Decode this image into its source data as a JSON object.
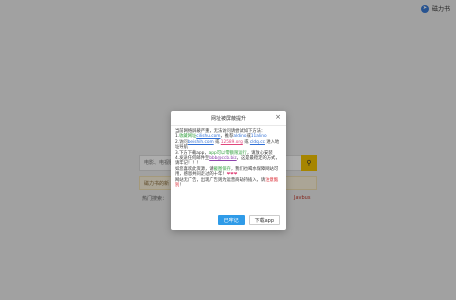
{
  "brand": {
    "name": "磁力书",
    "icon": "send-icon"
  },
  "search": {
    "placeholder": "电影、电视剧",
    "button_icon": "search-icon"
  },
  "notice": {
    "text": "磁力书的新"
  },
  "hot": {
    "label": "热门搜索：",
    "tail": "Javbus"
  },
  "modal": {
    "title": "网址被屏蔽提升",
    "close": "×",
    "lines": {
      "l1": "当前网络屏蔽严重，无法访问请尝试如下方法：",
      "l2a": "1.",
      "l2b": "收藏网址",
      "l2c": "cilishu.com",
      "l2d": "，推荐",
      "l2e": "aldino",
      "l2f": "或",
      "l2g": "11alino",
      "l3a": "2.访问",
      "l3b": "beishih.com",
      "l3c": " 或 ",
      "l3d": "12589.org",
      "l3e": " 或 ",
      "l3f": "cldq.cc",
      "l3g": " 进入地址导航",
      "l4a": "3.下方下载app，",
      "l4b": "app可以零额限运行",
      "l4c": "，请放心安装",
      "l5a": "4.发送任何邮件至",
      "l5b": "bbb@ccb.biz",
      "l5c": "，这是最稳定的方式，请牢记！！！",
      "l6a": "如您喜欢此资源，请",
      "l6b": "截图保存",
      "l6c": "，我们也喝水保障网站可用，感恩共同走过的十年！",
      "l6d": "❤❤❤",
      "l7a": "网站无广告，出现广告则为运营商劫持插入，请",
      "l7b": "注意甄别",
      "l7c": "！"
    },
    "btn_primary": "已牢记",
    "btn_secondary": "下载app"
  },
  "colors": {
    "accent": "#2f9be8",
    "search_button": "#f5c400",
    "overlay": "rgba(0,0,0,0.32)"
  }
}
